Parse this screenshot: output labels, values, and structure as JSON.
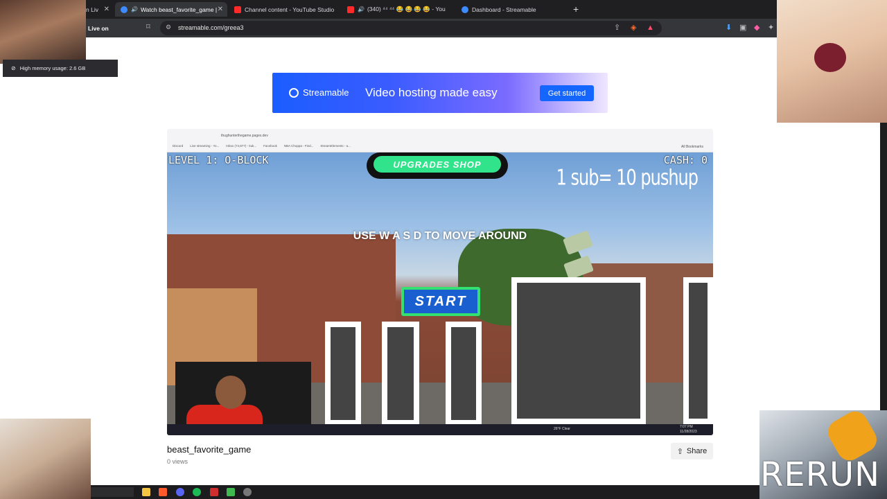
{
  "browser": {
    "tabs": [
      {
        "label": "n Liv",
        "active": false,
        "favicon_color": "#ff3d3d"
      },
      {
        "label": "Watch beast_favorite_game |",
        "active": true,
        "favicon_color": "#3d8bff",
        "close": "✕"
      },
      {
        "label": "Channel content - YouTube Studio",
        "active": false,
        "favicon_color": "#ff2a2a"
      },
      {
        "label": "(340) ⁴⁴ ⁴⁴ 😂 😂 😂 😂 - You",
        "active": false,
        "favicon_color": "#ff2a2a"
      },
      {
        "label": "Dashboard - Streamable",
        "active": false,
        "favicon_color": "#3d8bff"
      }
    ],
    "close_glyph": "✕",
    "new_tab": "+",
    "url": "streamable.com/greea3"
  },
  "overlay": {
    "live_label": "Live on",
    "memory_tooltip": "High memory usage: 2.6 GB",
    "rerun": "RERUN"
  },
  "banner": {
    "brand": "Streamable",
    "tagline": "Video hosting made easy",
    "cta": "Get started",
    "gradient_start": "#1b5dff",
    "gradient_end": "#efe7ff"
  },
  "video": {
    "inner_url": "thughunterthegame.pages.dev",
    "inner_bookmarks": [
      "Discord",
      "Live streaming - Yo...",
      "Inbox (74,877) - kuk...",
      "Facebook",
      "NBA Choppa - Find...",
      "StreamElements - a..."
    ],
    "inner_all_bookmarks": "All Bookmarks",
    "game": {
      "level": "LEVEL 1: O-BLOCK",
      "cash": "CASH: 0",
      "sub_note": "1 sub= 10 pushup",
      "upgrades_button": "UPGRADES SHOP",
      "instructions": "USE W A S D TO MOVE AROUND",
      "start_button": "START"
    },
    "taskbar_weather": "26°F  Clear",
    "taskbar_time": "7:07 PM",
    "taskbar_date": "11/28/2023"
  },
  "meta": {
    "title": "beast_favorite_game",
    "views": "0 views",
    "share_label": "Share"
  },
  "colors": {
    "accent": "#1565ff",
    "tabstrip_bg": "#1f1f22",
    "toolbar_bg": "#35363a",
    "upgrades_green": "#31e38a",
    "start_blue": "#1a5fd0"
  }
}
